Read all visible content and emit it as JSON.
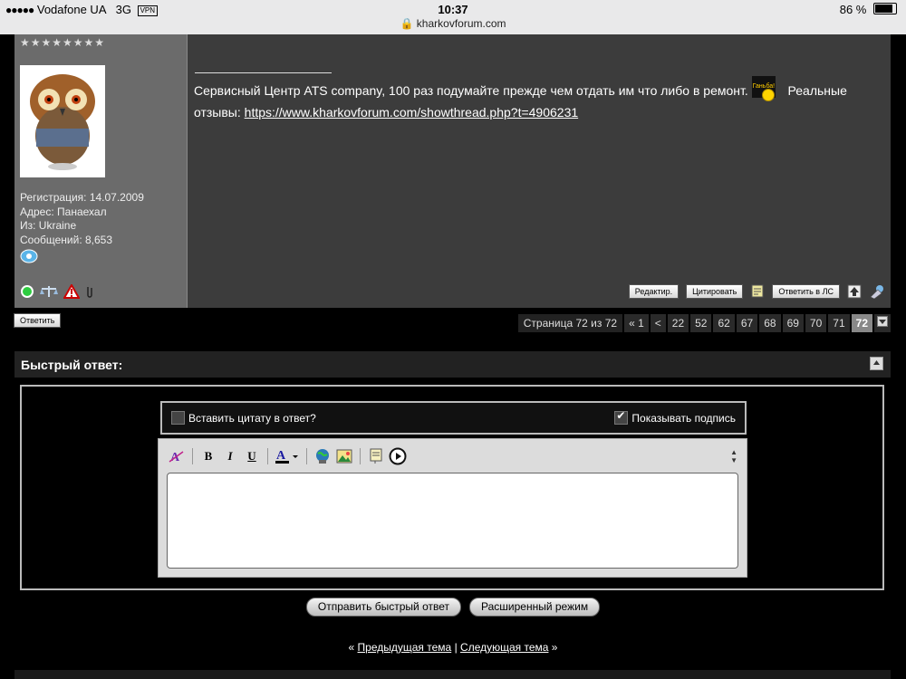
{
  "status_bar": {
    "carrier": "Vodafone UA",
    "network": "3G",
    "vpn": "VPN",
    "time": "10:37",
    "url": "kharkovforum.com",
    "battery": "86 %",
    "battery_level": 0.86
  },
  "post": {
    "stars": "★★★★★★★★",
    "user_info": {
      "registration": "Регистрация: 14.07.2009",
      "address": "Адрес: Панаехал",
      "from": "Из: Ukraine",
      "posts": "Сообщений: 8,653"
    },
    "signature": {
      "text": "Сервисный Центр ATS company, 100 раз подумайте прежде чем отдать им что либо в ремонт.",
      "smiley_label": "Ганьба!",
      "reviews_label": "Реальные отзывы:",
      "link": "https://www.kharkovforum.com/showthread.php?t=4906231"
    },
    "actions": {
      "edit": "Редактир.",
      "quote": "Цитировать",
      "reply_pm": "Ответить в ЛС"
    }
  },
  "reply_button": "Ответить",
  "pagination": {
    "label": "Страница 72 из 72",
    "first": "« 1",
    "prev": "<",
    "pages": [
      "22",
      "52",
      "62",
      "67",
      "68",
      "69",
      "70",
      "71"
    ],
    "current": "72"
  },
  "quick_reply": {
    "title": "Быстрый ответ:",
    "insert_quote": "Вставить цитату в ответ?",
    "show_signature": "Показывать подпись",
    "insert_quote_checked": false,
    "show_signature_checked": true,
    "textarea_value": "",
    "submit": "Отправить быстрый ответ",
    "advanced": "Расширенный режим"
  },
  "thread_nav": {
    "prev": "Предыдущая тема",
    "separator": "|",
    "next": "Следующая тема",
    "left_arrow": "«",
    "right_arrow": "»"
  },
  "colors": {
    "page_bg": "#000000",
    "post_bg": "#3c3c3c",
    "user_panel_bg": "#6b6b6b",
    "pager_current": "#888888"
  }
}
